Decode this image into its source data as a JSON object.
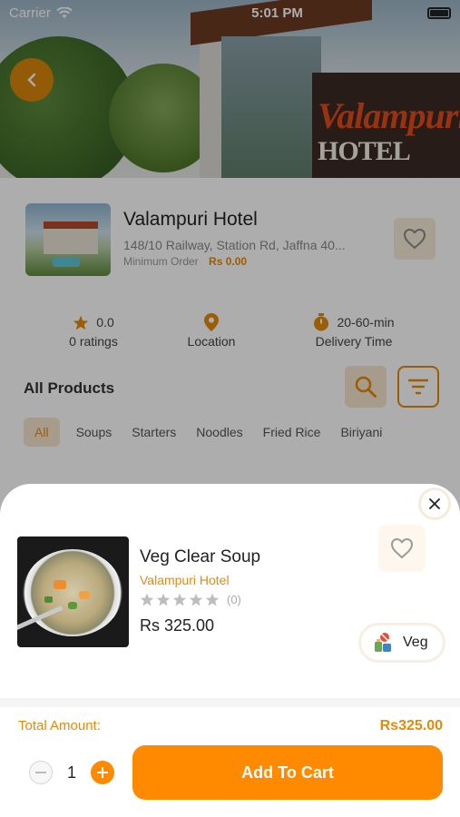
{
  "status_bar": {
    "carrier": "Carrier",
    "time": "5:01 PM",
    "wifi_icon": "wifi-icon",
    "battery_icon": "battery-icon"
  },
  "hero": {
    "sign_text": "Valampuri",
    "sign_sub": "HOTEL",
    "back_icon": "chevron-left-icon"
  },
  "restaurant": {
    "name": "Valampuri Hotel",
    "address": "148/10 Railway, Station Rd, Jaffna 40...",
    "min_order_label": "Minimum Order",
    "min_order_value": "Rs 0.00",
    "favorite_icon": "heart-icon"
  },
  "stats": {
    "rating_value": "0.0",
    "rating_label": "0 ratings",
    "location_label": "Location",
    "delivery_value": "20-60-min",
    "delivery_label": "Delivery Time"
  },
  "products_header": {
    "title": "All Products",
    "search_icon": "search-icon",
    "filter_icon": "filter-icon"
  },
  "categories": [
    "All",
    "Soups",
    "Starters",
    "Noodles",
    "Fried Rice",
    "Biriyani"
  ],
  "active_category": "All",
  "sheet": {
    "close_icon": "close-icon",
    "product": {
      "name": "Veg Clear Soup",
      "restaurant": "Valampuri Hotel",
      "rating_stars": 0,
      "rating_count": "(0)",
      "price": "Rs 325.00",
      "veg_label": "Veg"
    },
    "total_label": "Total Amount:",
    "total_value": "Rs325.00",
    "quantity": "1",
    "add_to_cart": "Add To Cart"
  },
  "colors": {
    "accent": "#ff8a00",
    "accent_text": "#e58a0a",
    "accent_soft": "#f7e6cd"
  }
}
